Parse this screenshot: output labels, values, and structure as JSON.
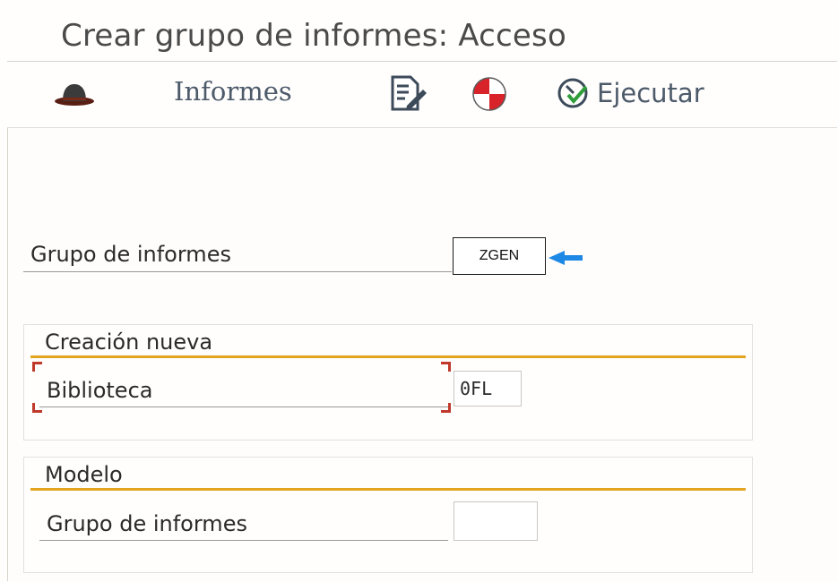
{
  "window": {
    "title": "Crear grupo de informes: Acceso"
  },
  "toolbar": {
    "informes_label": "Informes",
    "ejecutar_label": "Ejecutar"
  },
  "form": {
    "grupo_label": "Grupo de informes",
    "grupo_value": "ZGEN"
  },
  "creacion": {
    "title": "Creación nueva",
    "biblioteca_label": "Biblioteca",
    "biblioteca_value": "0FL"
  },
  "modelo": {
    "title": "Modelo",
    "grupo_label": "Grupo de informes",
    "grupo_value": ""
  },
  "colors": {
    "accent_gold": "#e3a51f",
    "pointer_blue": "#1e88e5",
    "required_red": "#c0392b"
  }
}
